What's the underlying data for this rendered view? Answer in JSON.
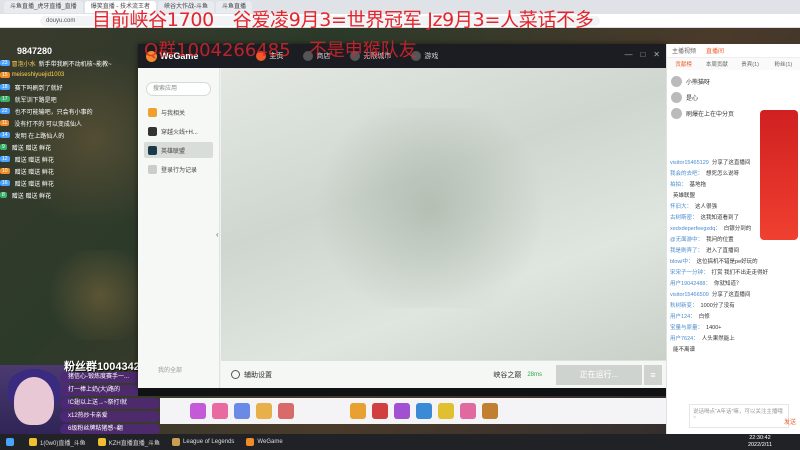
{
  "browser": {
    "tabs": [
      "斗鱼直播_虎牙直播_直播",
      "爆笑直播 - 技术流王者",
      "峡谷大作战-斗鱼",
      "斗鱼直播"
    ],
    "url": "douyu.com"
  },
  "overlay": {
    "line1": "目前峡谷1700　谷爱凌9月3=世界冠军 Jz9月3=人菜话不多",
    "line2": "Q群1004266485　不是申猴队友"
  },
  "stream": {
    "follower_count": "9847280",
    "fan_group": "粉丝群100434231"
  },
  "left_chat": [
    {
      "badge": "23",
      "name": "冒泡小水",
      "msg": "新手带我刷不动机核~能教~"
    },
    {
      "badge": "15",
      "name": "meiseshiyuejid1003",
      "msg": ""
    },
    {
      "badge": "18",
      "name": "",
      "msg": "赛下吗刷到了就好"
    },
    {
      "badge": "17",
      "name": "",
      "msg": "就军训下路是吧"
    },
    {
      "badge": "22",
      "name": "",
      "msg": "也不可能输吧，只会有小事的"
    },
    {
      "badge": "11",
      "name": "",
      "msg": "没有打不的 可以变成仙人"
    },
    {
      "badge": "14",
      "name": "",
      "msg": "发明 在上路仙人的"
    },
    {
      "badge": "9",
      "name": "",
      "msg": "赠送 赠送 鲜花"
    },
    {
      "badge": "12",
      "name": "",
      "msg": "赠送 赠送 鲜花"
    },
    {
      "badge": "10",
      "name": "",
      "msg": "赠送 赠送 鲜花"
    },
    {
      "badge": "16",
      "name": "",
      "msg": "赠送 赠送 鲜花"
    },
    {
      "badge": "8",
      "name": "",
      "msg": "赠送 赠送 鲜花"
    }
  ],
  "gift_notices": [
    "猪信心-锻炼度赛手一...",
    "打一棒上奶(大)路的",
    "!C翅以上送→~祭打!就",
    "x12热炒卡亲爱",
    "6级粉丝牌粘猪感~翻"
  ],
  "wegame": {
    "logo": "WeGame",
    "nav": [
      "主页",
      "商店",
      "无限城市",
      "游戏"
    ],
    "search_placeholder": "搜索应用",
    "sidebar": [
      "与我相关",
      "穿越火线+H...",
      "英雄联盟",
      "登录行为记录"
    ],
    "sidebar_bottom": "我的全部",
    "settings_label": "辅助设置",
    "server": "峡谷之巅",
    "ping": "28ms",
    "launch_label": "正在运行..."
  },
  "right_panel": {
    "tabs": [
      "主播视频",
      "直播间"
    ],
    "subtabs": [
      "贡献榜",
      "本周贡献",
      "贵宾(1)",
      "粉丝(1)"
    ],
    "ranks": [
      "小熊猫呀",
      "是心",
      "刷爆在上在中分页"
    ],
    "chat": [
      {
        "name": "visitor15465129",
        "msg": "分享了这直播间"
      },
      {
        "name": "我会的去吧：",
        "msg": "想死怎么说呀"
      },
      {
        "name": "拍拍：",
        "msg": "基地拖"
      },
      {
        "name": "",
        "msg": "英雄联盟"
      },
      {
        "name": "怀旧大：",
        "msg": "这人很强"
      },
      {
        "name": "古树斯密：",
        "msg": "这我知道看到了"
      },
      {
        "name": "xedxdeperfeegxdq：",
        "msg": "白银分到的"
      },
      {
        "name": "@无面游中：",
        "msg": "我问的位置"
      },
      {
        "name": "我是刷弄了：",
        "msg": "进入了直播间"
      },
      {
        "name": "blowi中：",
        "msg": "这位搞机不错是pe好玩的"
      },
      {
        "name": "宋宋子一分钟：",
        "msg": "打赏 我们不出走走得好"
      },
      {
        "name": "用户19042488：",
        "msg": "你就知道？"
      },
      {
        "name": "visitor15466509",
        "msg": "分享了这直播间"
      },
      {
        "name": "秋树新变：",
        "msg": "1000分了没有"
      },
      {
        "name": "用户124：",
        "msg": "白修"
      },
      {
        "name": "宝量与原量：",
        "msg": "1400+"
      },
      {
        "name": "用户7624：",
        "msg": "人头果然能上"
      },
      {
        "name": "",
        "msg": "能不离谱"
      }
    ],
    "input_placeholder": "说话喝点“A年话”嘛，可以关注主播哦~",
    "send_label": "发送"
  },
  "taskbar": {
    "items": [
      "1(0w0)直播_斗鱼",
      "KZH直播直播_斗鱼",
      "League of Legends",
      "WeGame"
    ],
    "time": "22:30:42",
    "date": "2022/2/11"
  }
}
